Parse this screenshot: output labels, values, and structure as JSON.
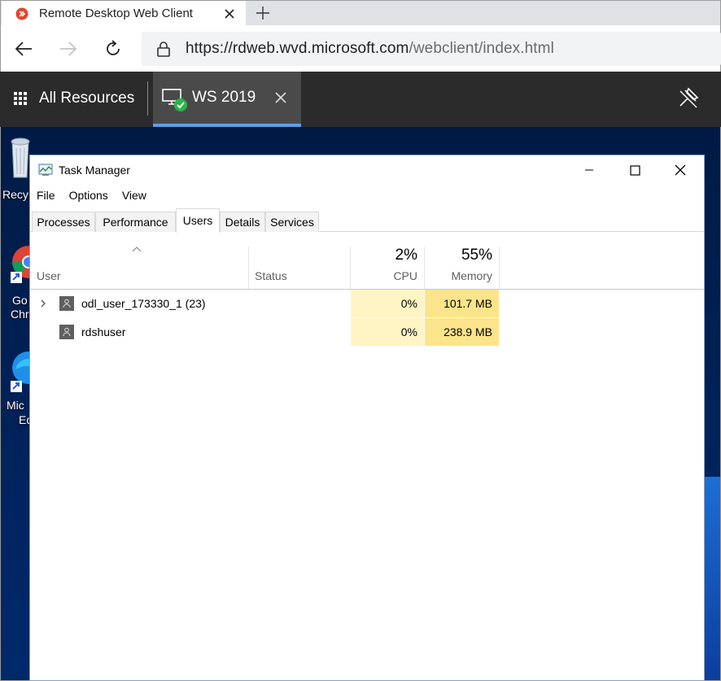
{
  "browser": {
    "tab_title": "Remote Desktop Web Client",
    "url_host": "https://rdweb.wvd.microsoft.com",
    "url_path": "/webclient/index.html"
  },
  "rd_client": {
    "all_resources_label": "All Resources",
    "session_label": "WS 2019",
    "session_status": "connected"
  },
  "desktop": {
    "icons": [
      {
        "name": "Recycle Bin",
        "visible_label": "Recy"
      },
      {
        "name": "Google Chrome",
        "visible_label_lines": [
          "Go",
          "Chr"
        ]
      },
      {
        "name": "Microsoft Edge",
        "visible_label_lines": [
          "Mic",
          "Ed"
        ]
      }
    ]
  },
  "task_manager": {
    "title": "Task Manager",
    "menu": [
      "File",
      "Options",
      "View"
    ],
    "tabs": [
      "Processes",
      "Performance",
      "Users",
      "Details",
      "Services"
    ],
    "active_tab": "Users",
    "columns": {
      "user": "User",
      "status": "Status",
      "cpu_total": "2%",
      "cpu": "CPU",
      "memory_total": "55%",
      "memory": "Memory"
    },
    "rows": [
      {
        "user": "odl_user_173330_1 (23)",
        "status": "",
        "cpu": "0%",
        "memory": "101.7 MB",
        "expandable": true
      },
      {
        "user": "rdshuser",
        "status": "",
        "cpu": "0%",
        "memory": "238.9 MB",
        "expandable": false
      }
    ]
  },
  "colors": {
    "rd_bar": "#2b2b2b",
    "session_accent": "#5aa0e6",
    "cpu_heat": "#fff4c4",
    "mem_heat": "#fce48a"
  }
}
